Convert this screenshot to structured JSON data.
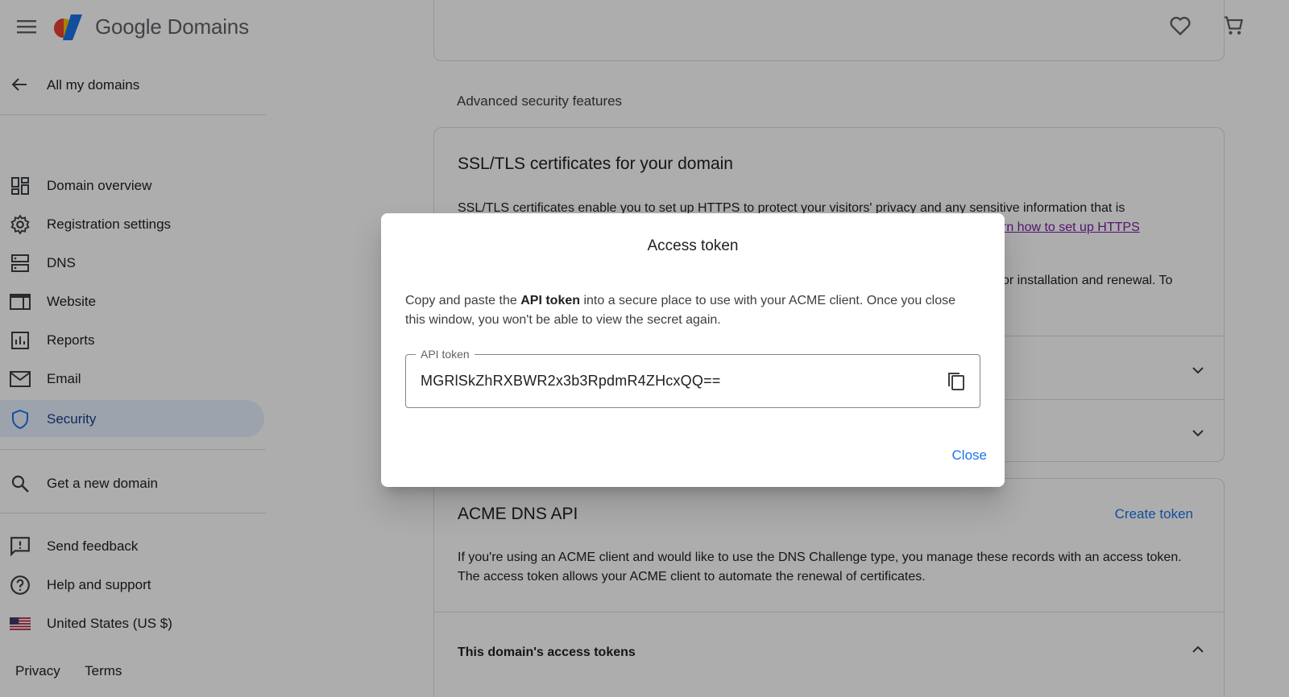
{
  "header": {
    "brand_google": "Google",
    "brand_product": "Domains",
    "icons": [
      "menu-icon",
      "google-domains-logo",
      "heart-icon",
      "cart-icon"
    ]
  },
  "sidebar": {
    "back_label": "All my domains",
    "items": [
      {
        "label": "Domain overview",
        "icon": "dashboard-icon"
      },
      {
        "label": "Registration settings",
        "icon": "gear-icon"
      },
      {
        "label": "DNS",
        "icon": "dns-icon"
      },
      {
        "label": "Website",
        "icon": "website-icon"
      },
      {
        "label": "Reports",
        "icon": "reports-icon"
      },
      {
        "label": "Email",
        "icon": "email-icon"
      },
      {
        "label": "Security",
        "icon": "shield-icon",
        "active": true
      }
    ],
    "extra_items": [
      {
        "label": "Get a new domain",
        "icon": "search-icon"
      }
    ],
    "support_items": [
      {
        "label": "Send feedback",
        "icon": "feedback-icon"
      },
      {
        "label": "Help and support",
        "icon": "help-icon"
      },
      {
        "label": "United States (US $)",
        "icon": "us-flag-icon"
      }
    ],
    "footer": {
      "privacy": "Privacy",
      "terms": "Terms"
    }
  },
  "main": {
    "section_heading": "Advanced security features",
    "ssl_card": {
      "title": "SSL/TLS certificates for your domain",
      "text_line1": "SSL/TLS certificates enable you to set up HTTPS to protect your visitors' privacy and any sensitive information that is",
      "link_partial": "rn how to set up HTTPS",
      "text_partial2": "or installation and renewal. To"
    },
    "acme_card": {
      "title": "ACME DNS API",
      "action": "Create token",
      "text": "If you're using an ACME client and would like to use the DNS Challenge type, you manage these records with an access token. The access token allows your ACME client to automate the renewal of certificates.",
      "tokens_heading": "This domain's access tokens"
    }
  },
  "dialog": {
    "title": "Access token",
    "body_prefix": "Copy and paste the ",
    "body_bold": "API token",
    "body_suffix": " into a secure place to use with your ACME client. Once you close this window, you won't be able to view the secret again.",
    "field_label": "API token",
    "token_value": "MGRlSkZhRXBWR2x3b3RpdmR4ZHcxQQ==",
    "close_label": "Close"
  },
  "colors": {
    "accent": "#1a73e8",
    "link_visited": "#7b1fa2",
    "active_nav_bg": "#e8f0fe",
    "scrim": "rgba(0,0,0,0.32)"
  }
}
